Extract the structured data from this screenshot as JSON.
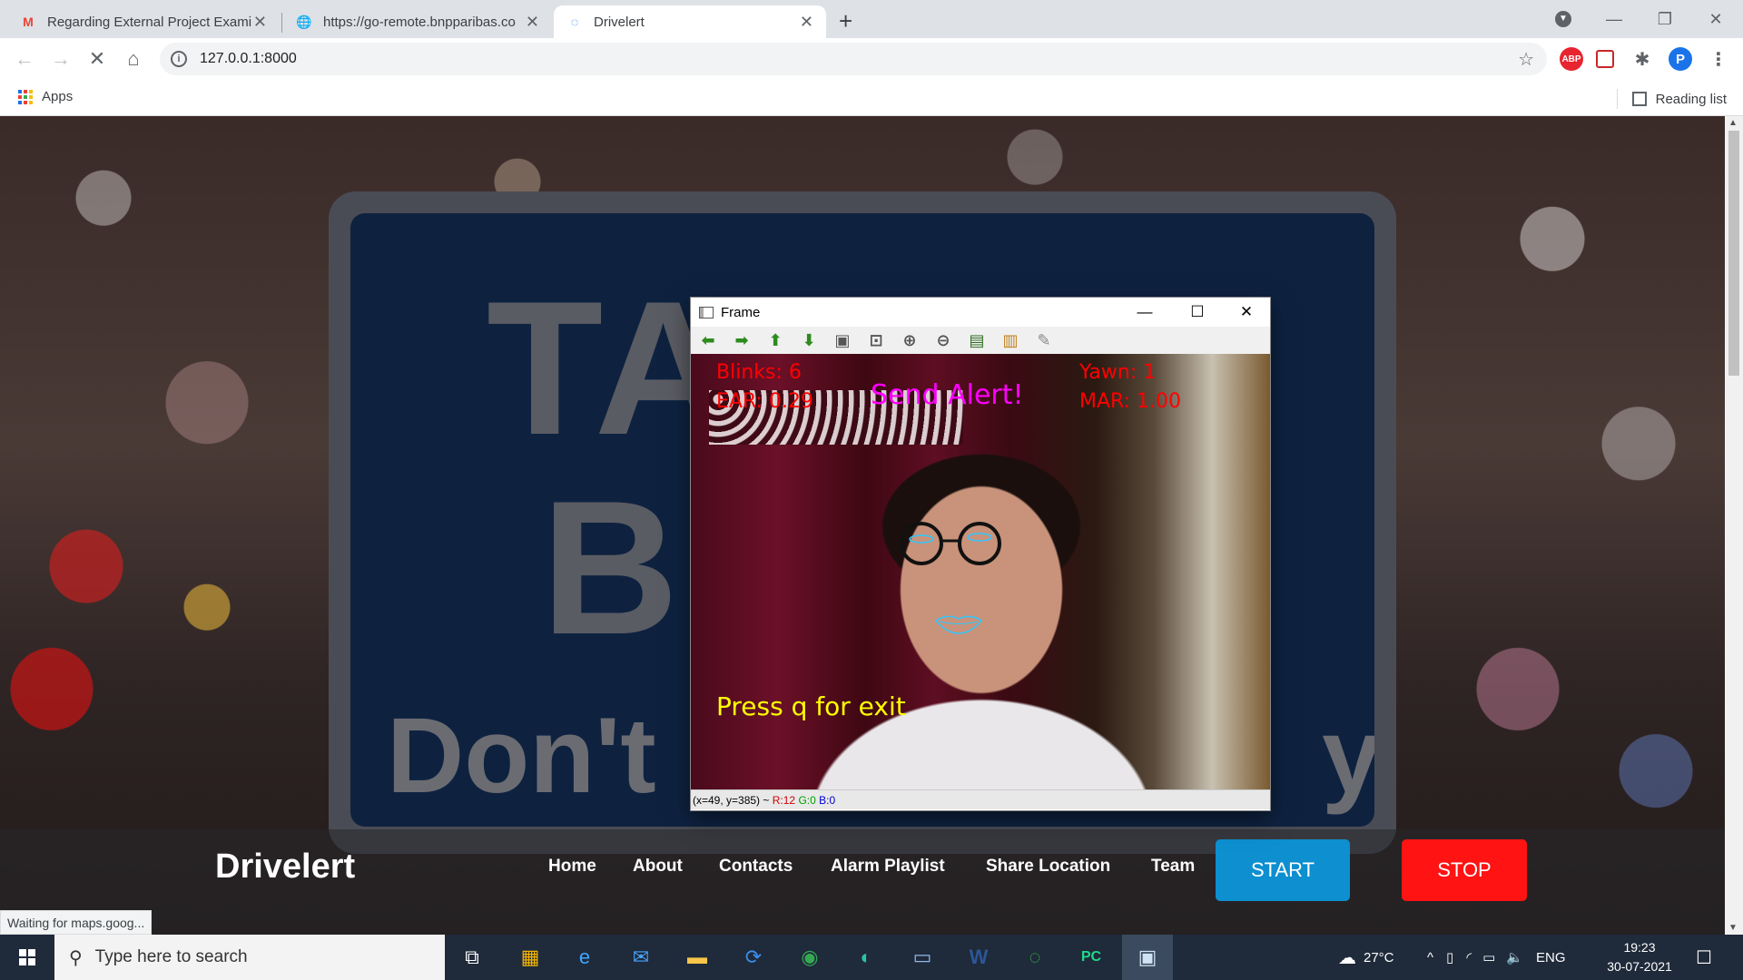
{
  "browser": {
    "tabs": [
      {
        "title": "Regarding External Project Exami",
        "icon": "gmail-icon",
        "active": false
      },
      {
        "title": "https://go-remote.bnpparibas.co",
        "icon": "globe-icon",
        "active": false
      },
      {
        "title": "Drivelert",
        "icon": "loading-spinner-icon",
        "active": true
      }
    ],
    "address": "127.0.0.1:8000",
    "bookmarks": {
      "apps_label": "Apps",
      "reading_list_label": "Reading list"
    },
    "profile_initial": "P",
    "abp_label": "ABP",
    "status_text": "Waiting for maps.goog..."
  },
  "site": {
    "sign_line1": "TAKE A",
    "sign_line2": "BREAK",
    "sign_line3_left": "Don't",
    "sign_line3_right": "y.",
    "brand": "Drivelert",
    "nav": [
      "Home",
      "About",
      "Contacts",
      "Alarm Playlist",
      "Share Location",
      "Team"
    ],
    "start_label": "START",
    "stop_label": "STOP",
    "start_color": "#0d8fd0",
    "stop_color": "#ff1313"
  },
  "frame_window": {
    "title": "Frame",
    "overlay": {
      "blinks": "Blinks: 6",
      "ear": "EAR: 0.29",
      "alert": "Send Alert!",
      "yawn": "Yawn: 1",
      "mar": "MAR: 1.00",
      "exit_hint": "Press q for exit"
    },
    "status": {
      "coords": "(x=49, y=385) ~ ",
      "r": "R:12",
      "g": "G:0",
      "b": "B:0"
    }
  },
  "taskbar": {
    "search_placeholder": "Type here to search",
    "weather": "27°C",
    "language": "ENG",
    "time": "19:23",
    "date": "30-07-2021"
  }
}
